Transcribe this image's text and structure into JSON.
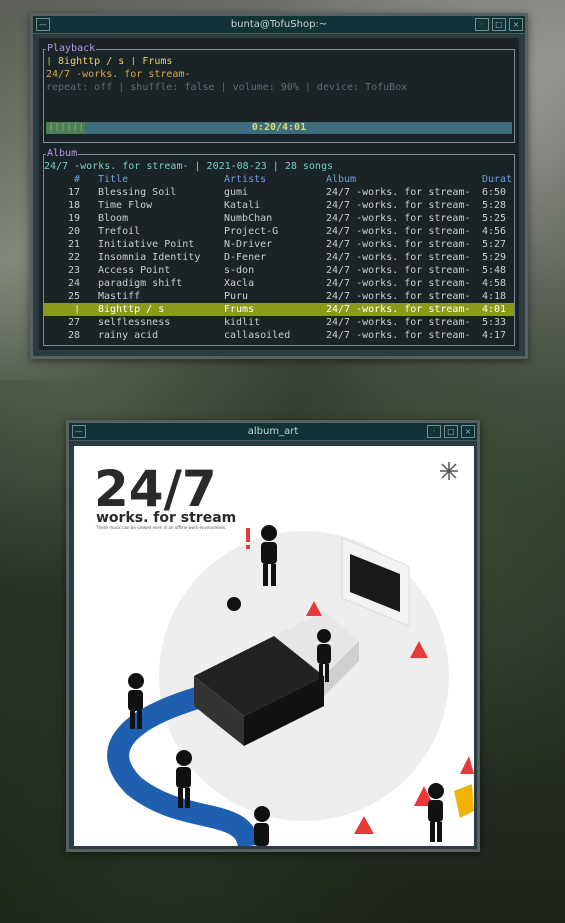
{
  "terminal": {
    "title": "bunta@TofuShop:~",
    "playback": {
      "label": "Playback",
      "now_playing": "❘ 8ighttp / s ❘ Frums",
      "album_line": "24/7 -works. for stream-",
      "status_line": "repeat: off | shuffle: false | volume: 90% | device: TofuBox",
      "progress_bars": "❘❘❘❘❘❘",
      "progress_time": "0:20/4:01",
      "progress_fraction": 0.083
    },
    "album": {
      "label": "Album",
      "header": "24/7 -works. for stream- | 2021-08-23 | 28 songs",
      "columns": {
        "num": "#",
        "title": "Title",
        "artist": "Artists",
        "album": "Album",
        "duration": "Durat"
      },
      "rows": [
        {
          "num": "17",
          "title": "Blessing Soil",
          "artist": "gumi",
          "album": "24/7 -works. for stream-",
          "duration": "6:50"
        },
        {
          "num": "18",
          "title": "Time Flow",
          "artist": "Katali",
          "album": "24/7 -works. for stream-",
          "duration": "5:28"
        },
        {
          "num": "19",
          "title": "Bloom",
          "artist": "NumbChan",
          "album": "24/7 -works. for stream-",
          "duration": "5:25"
        },
        {
          "num": "20",
          "title": "Trefoil",
          "artist": "Project-G",
          "album": "24/7 -works. for stream-",
          "duration": "4:56"
        },
        {
          "num": "21",
          "title": "Initiative Point",
          "artist": "N-Driver",
          "album": "24/7 -works. for stream-",
          "duration": "5:27"
        },
        {
          "num": "22",
          "title": "Insomnia Identity",
          "artist": "D-Fener",
          "album": "24/7 -works. for stream-",
          "duration": "5:29"
        },
        {
          "num": "23",
          "title": "Access Point",
          "artist": "s-don",
          "album": "24/7 -works. for stream-",
          "duration": "5:48"
        },
        {
          "num": "24",
          "title": "paradigm shift",
          "artist": "Xacla",
          "album": "24/7 -works. for stream-",
          "duration": "4:58"
        },
        {
          "num": "25",
          "title": "Mastiff",
          "artist": "Puru",
          "album": "24/7 -works. for stream-",
          "duration": "4:18"
        },
        {
          "num": "❘",
          "title": "8ighttp / s",
          "artist": "Frums",
          "album": "24/7 -works. for stream-",
          "duration": "4:01"
        },
        {
          "num": "27",
          "title": "selflessness",
          "artist": "kidlit",
          "album": "24/7 -works. for stream-",
          "duration": "5:33"
        },
        {
          "num": "28",
          "title": "rainy acid",
          "artist": "callasoiled",
          "album": "24/7 -works. for stream-",
          "duration": "4:17"
        }
      ],
      "selected_index": 9
    }
  },
  "album_art_window": {
    "title": "album_art",
    "cover": {
      "big_title": "24/7",
      "subtitle": "works. for stream",
      "tagline": "These music can be viewed even in an offline work environment."
    }
  },
  "colors": {
    "selected_row": "#8a9a1a",
    "now_playing": "#e7d36b",
    "accent_cyan": "#6fd0cf",
    "header_blue": "#6f9fe0",
    "cable_blue": "#1f5fb0"
  }
}
